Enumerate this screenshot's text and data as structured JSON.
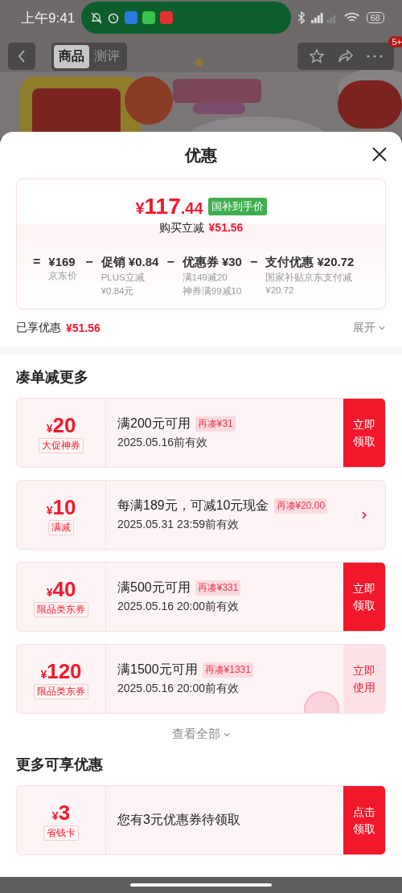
{
  "status_bar": {
    "time": "上午9:41",
    "battery": "68"
  },
  "nav": {
    "tabs": [
      {
        "label": "商品",
        "selected": true
      },
      {
        "label": "测评",
        "selected": false
      }
    ],
    "badge": "5+"
  },
  "sheet": {
    "title": "优惠",
    "summary": {
      "currency": "¥",
      "integer": "117",
      "decimal": ".44",
      "tag": "国补到手价",
      "saving_label": "购买立减",
      "saving_amount": "¥51.56",
      "breakdown": [
        {
          "op": "=",
          "amount": "¥169",
          "notes": [
            "京东价"
          ]
        },
        {
          "op": "−",
          "label": "促销",
          "amount": "¥0.84",
          "notes": [
            "PLUS立减",
            "¥0.84元"
          ]
        },
        {
          "op": "−",
          "label": "优惠券",
          "amount": "¥30",
          "notes": [
            "满149减20",
            "神券满99减10"
          ]
        },
        {
          "op": "−",
          "label": "支付优惠",
          "amount": "¥20.72",
          "notes": [
            "国家补贴京东支付减",
            "¥20.72"
          ]
        }
      ]
    },
    "enjoyed": {
      "label": "已享优惠",
      "amount": "¥51.56",
      "expand": "展开"
    },
    "sections": [
      {
        "title": "凑单减更多",
        "coupons": [
          {
            "currency": "¥",
            "amount": "20",
            "tag": "大促神券",
            "condition": "满200元可用",
            "extra": "再凑¥31",
            "validity": "2025.05.16前有效",
            "action": {
              "kind": "claim",
              "lines": [
                "立即",
                "领取"
              ]
            },
            "used_stamp": false
          },
          {
            "currency": "¥",
            "amount": "10",
            "tag": "满减",
            "condition": "每满189元，可减10元现金",
            "extra": "再凑¥20.00",
            "validity": "2025.05.31 23:59前有效",
            "action": {
              "kind": "arrow"
            },
            "used_stamp": false
          },
          {
            "currency": "¥",
            "amount": "40",
            "tag": "限品类东券",
            "condition": "满500元可用",
            "extra": "再凑¥331",
            "validity": "2025.05.16 20:00前有效",
            "action": {
              "kind": "claim",
              "lines": [
                "立即",
                "领取"
              ]
            },
            "used_stamp": false
          },
          {
            "currency": "¥",
            "amount": "120",
            "tag": "限品类东券",
            "condition": "满1500元可用",
            "extra": "再凑¥1331",
            "validity": "2025.05.16 20:00前有效",
            "action": {
              "kind": "use",
              "lines": [
                "立即",
                "使用"
              ]
            },
            "used_stamp": true
          }
        ],
        "more": "查看全部"
      },
      {
        "title": "更多可享优惠",
        "coupons": [
          {
            "currency": "¥",
            "amount": "3",
            "tag": "省钱卡",
            "condition": "您有3元优惠券待领取",
            "action": {
              "kind": "claim",
              "lines": [
                "点击",
                "领取"
              ]
            },
            "used_stamp": false
          }
        ]
      }
    ]
  }
}
